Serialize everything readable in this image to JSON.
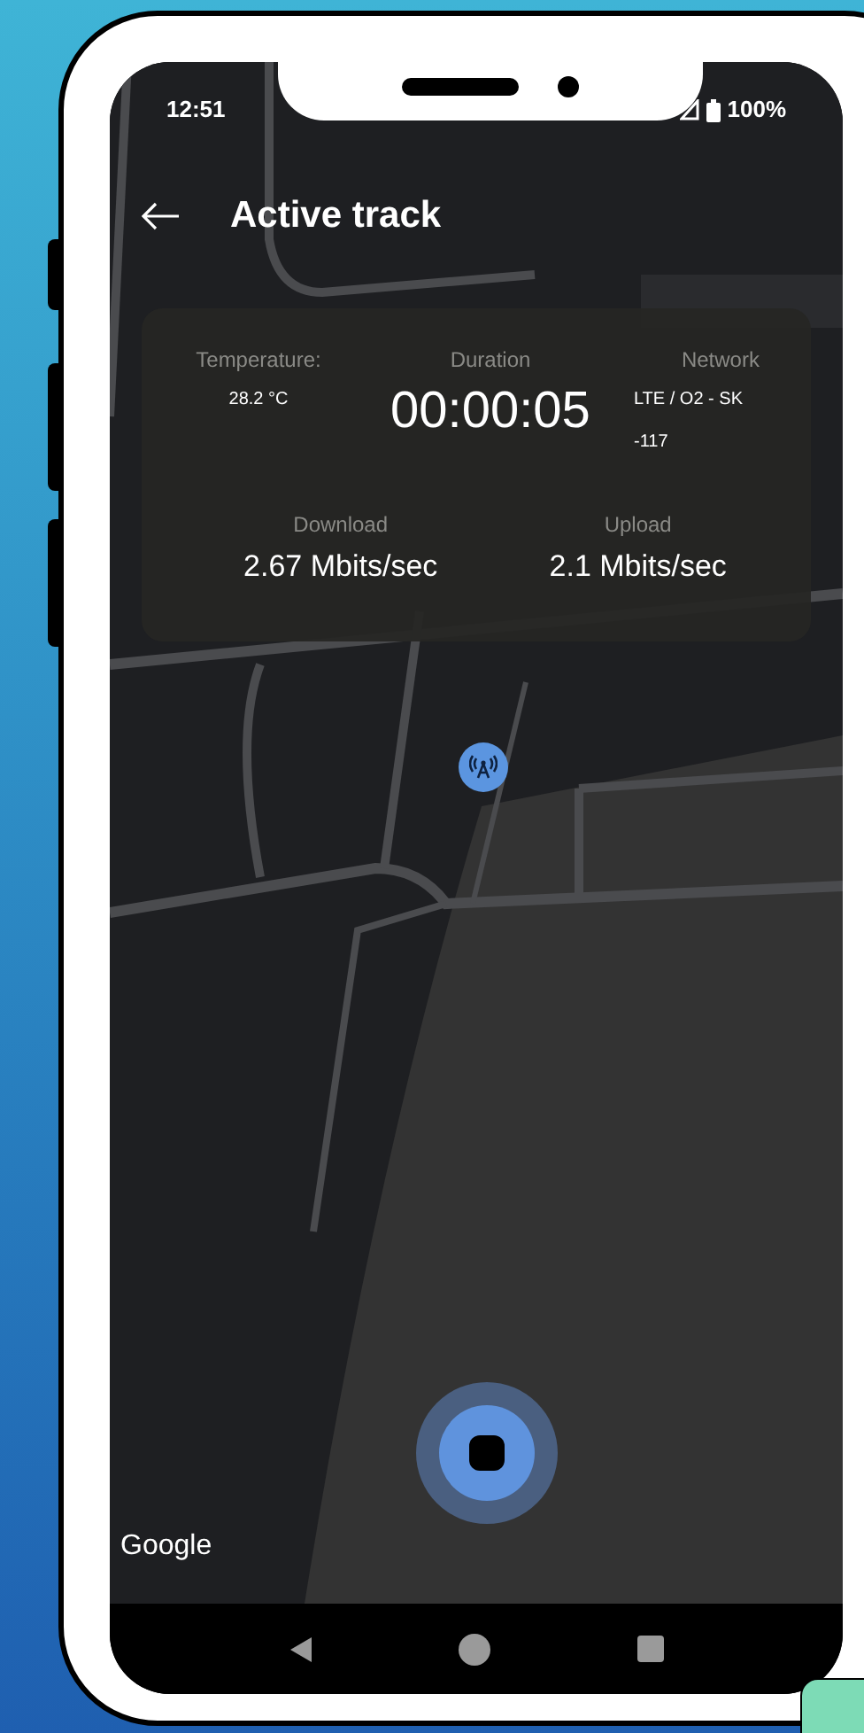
{
  "status_bar": {
    "time": "12:51",
    "battery": "100%"
  },
  "app_bar": {
    "title": "Active track"
  },
  "stats": {
    "temperature": {
      "label": "Temperature:",
      "value": "28.2 °C"
    },
    "duration": {
      "label": "Duration",
      "value": "00:00:05"
    },
    "network": {
      "label": "Network",
      "operator": "LTE / O2 - SK",
      "signal": "-117"
    },
    "download": {
      "label": "Download",
      "value": "2.67 Mbits/sec"
    },
    "upload": {
      "label": "Upload",
      "value": "2.1 Mbits/sec"
    }
  },
  "map": {
    "attribution": "Google"
  }
}
